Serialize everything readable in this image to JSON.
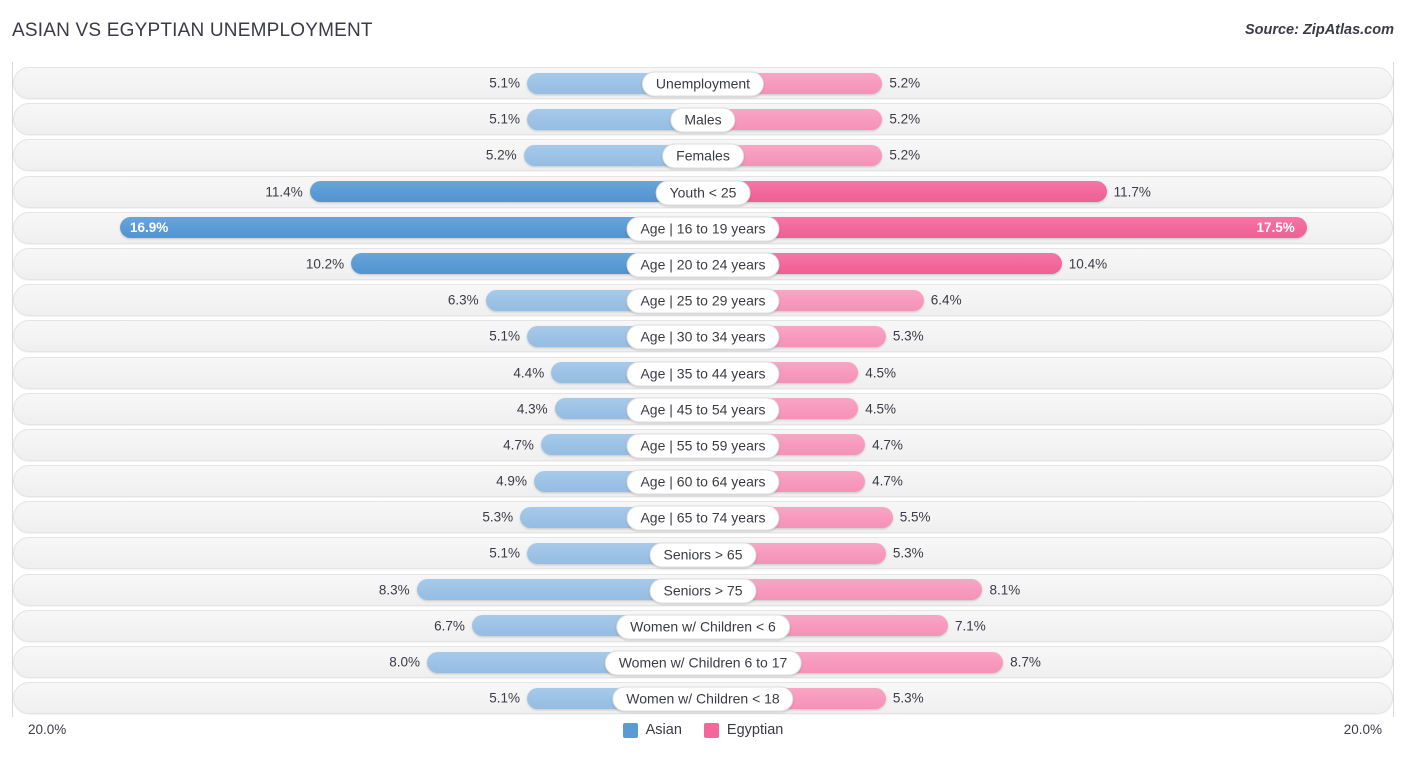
{
  "header": {
    "title": "ASIAN VS EGYPTIAN UNEMPLOYMENT",
    "source": "Source: ZipAtlas.com"
  },
  "axis": {
    "left_label": "20.0%",
    "right_label": "20.0%"
  },
  "legend": {
    "items": [
      {
        "label": "Asian",
        "color": "#5b9bd5"
      },
      {
        "label": "Egyptian",
        "color": "#f2689b"
      }
    ]
  },
  "colors": {
    "blue_light": "#9cc2e5",
    "blue_dark": "#5b9bd5",
    "pink_light": "#f799bd",
    "pink_dark": "#f2689b",
    "track": "#f4f4f4",
    "text": "#3b3b46"
  },
  "chart_data": {
    "type": "bar",
    "title": "ASIAN VS EGYPTIAN UNEMPLOYMENT",
    "subtitle": "Source: ZipAtlas.com",
    "orientation": "horizontal-diverging",
    "xlabel": "",
    "ylabel": "",
    "axis_max": 20.0,
    "unit": "%",
    "grid": false,
    "legend_position": "bottom-center",
    "categories": [
      "Unemployment",
      "Males",
      "Females",
      "Youth < 25",
      "Age | 16 to 19 years",
      "Age | 20 to 24 years",
      "Age | 25 to 29 years",
      "Age | 30 to 34 years",
      "Age | 35 to 44 years",
      "Age | 45 to 54 years",
      "Age | 55 to 59 years",
      "Age | 60 to 64 years",
      "Age | 65 to 74 years",
      "Seniors > 65",
      "Seniors > 75",
      "Women w/ Children < 6",
      "Women w/ Children 6 to 17",
      "Women w/ Children < 18"
    ],
    "series": [
      {
        "name": "Asian",
        "color": "#9cc2e5",
        "values": [
          5.1,
          5.1,
          5.2,
          11.4,
          16.9,
          10.2,
          6.3,
          5.1,
          4.4,
          4.3,
          4.7,
          4.9,
          5.3,
          5.1,
          8.3,
          6.7,
          8.0,
          5.1
        ],
        "labels": [
          "5.1%",
          "5.1%",
          "5.2%",
          "11.4%",
          "16.9%",
          "10.2%",
          "6.3%",
          "5.1%",
          "4.4%",
          "4.3%",
          "4.7%",
          "4.9%",
          "5.3%",
          "5.1%",
          "8.3%",
          "6.7%",
          "8.0%",
          "5.1%"
        ]
      },
      {
        "name": "Egyptian",
        "color": "#f799bd",
        "values": [
          5.2,
          5.2,
          5.2,
          11.7,
          17.5,
          10.4,
          6.4,
          5.3,
          4.5,
          4.5,
          4.7,
          4.7,
          5.5,
          5.3,
          8.1,
          7.1,
          8.7,
          5.3
        ],
        "labels": [
          "5.2%",
          "5.2%",
          "5.2%",
          "11.7%",
          "17.5%",
          "10.4%",
          "6.4%",
          "5.3%",
          "4.5%",
          "4.5%",
          "4.7%",
          "4.7%",
          "5.5%",
          "5.3%",
          "8.1%",
          "7.1%",
          "8.7%",
          "5.3%"
        ]
      }
    ]
  },
  "rows": [
    {
      "label": "Unemployment",
      "left": "5.1%",
      "right": "5.2%",
      "lv": 5.1,
      "rv": 5.2,
      "tone": "light",
      "inside": false
    },
    {
      "label": "Males",
      "left": "5.1%",
      "right": "5.2%",
      "lv": 5.1,
      "rv": 5.2,
      "tone": "light",
      "inside": false
    },
    {
      "label": "Females",
      "left": "5.2%",
      "right": "5.2%",
      "lv": 5.2,
      "rv": 5.2,
      "tone": "light",
      "inside": false
    },
    {
      "label": "Youth < 25",
      "left": "11.4%",
      "right": "11.7%",
      "lv": 11.4,
      "rv": 11.7,
      "tone": "dark",
      "inside": false
    },
    {
      "label": "Age | 16 to 19 years",
      "left": "16.9%",
      "right": "17.5%",
      "lv": 16.9,
      "rv": 17.5,
      "tone": "dark",
      "inside": true
    },
    {
      "label": "Age | 20 to 24 years",
      "left": "10.2%",
      "right": "10.4%",
      "lv": 10.2,
      "rv": 10.4,
      "tone": "dark",
      "inside": false
    },
    {
      "label": "Age | 25 to 29 years",
      "left": "6.3%",
      "right": "6.4%",
      "lv": 6.3,
      "rv": 6.4,
      "tone": "light",
      "inside": false
    },
    {
      "label": "Age | 30 to 34 years",
      "left": "5.1%",
      "right": "5.3%",
      "lv": 5.1,
      "rv": 5.3,
      "tone": "light",
      "inside": false
    },
    {
      "label": "Age | 35 to 44 years",
      "left": "4.4%",
      "right": "4.5%",
      "lv": 4.4,
      "rv": 4.5,
      "tone": "light",
      "inside": false
    },
    {
      "label": "Age | 45 to 54 years",
      "left": "4.3%",
      "right": "4.5%",
      "lv": 4.3,
      "rv": 4.5,
      "tone": "light",
      "inside": false
    },
    {
      "label": "Age | 55 to 59 years",
      "left": "4.7%",
      "right": "4.7%",
      "lv": 4.7,
      "rv": 4.7,
      "tone": "light",
      "inside": false
    },
    {
      "label": "Age | 60 to 64 years",
      "left": "4.9%",
      "right": "4.7%",
      "lv": 4.9,
      "rv": 4.7,
      "tone": "light",
      "inside": false
    },
    {
      "label": "Age | 65 to 74 years",
      "left": "5.3%",
      "right": "5.5%",
      "lv": 5.3,
      "rv": 5.5,
      "tone": "light",
      "inside": false
    },
    {
      "label": "Seniors > 65",
      "left": "5.1%",
      "right": "5.3%",
      "lv": 5.1,
      "rv": 5.3,
      "tone": "light",
      "inside": false
    },
    {
      "label": "Seniors > 75",
      "left": "8.3%",
      "right": "8.1%",
      "lv": 8.3,
      "rv": 8.1,
      "tone": "light",
      "inside": false
    },
    {
      "label": "Women w/ Children < 6",
      "left": "6.7%",
      "right": "7.1%",
      "lv": 6.7,
      "rv": 7.1,
      "tone": "light",
      "inside": false
    },
    {
      "label": "Women w/ Children 6 to 17",
      "left": "8.0%",
      "right": "8.7%",
      "lv": 8.0,
      "rv": 8.7,
      "tone": "light",
      "inside": false
    },
    {
      "label": "Women w/ Children < 18",
      "left": "5.1%",
      "right": "5.3%",
      "lv": 5.1,
      "rv": 5.3,
      "tone": "light",
      "inside": false
    }
  ]
}
